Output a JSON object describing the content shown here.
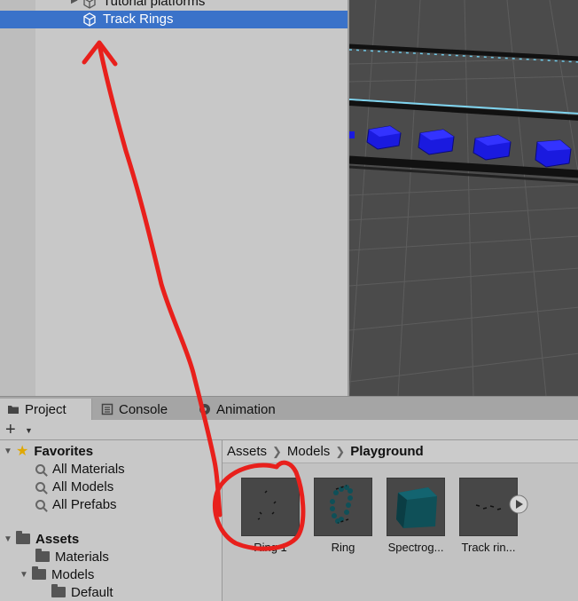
{
  "hierarchy": {
    "items": [
      {
        "label": "Tutorial platforms",
        "selected": false
      },
      {
        "label": "Track Rings",
        "selected": true
      }
    ]
  },
  "tabs": [
    {
      "label": "Project",
      "icon": "folder-icon",
      "active": true
    },
    {
      "label": "Console",
      "icon": "console-icon",
      "active": false
    },
    {
      "label": "Animation",
      "icon": "animation-icon",
      "active": false
    }
  ],
  "toolbar": {
    "add_label": "+",
    "add_icon": "chevron-down-icon"
  },
  "tree": {
    "favorites": {
      "label": "Favorites",
      "items": [
        "All Materials",
        "All Models",
        "All Prefabs"
      ]
    },
    "assets": {
      "label": "Assets",
      "items": [
        "Materials",
        "Models",
        "Default"
      ]
    }
  },
  "breadcrumb": [
    "Assets",
    "Models",
    "Playground"
  ],
  "assets": [
    {
      "name": "Ring 1"
    },
    {
      "name": "Ring"
    },
    {
      "name": "Spectrog..."
    },
    {
      "name": "Track rin..."
    }
  ],
  "colors": {
    "selection": "#3a72c9",
    "annotation": "#e8201c",
    "scene_bg": "#4b4b4b",
    "cube_blue": "#1a1adf",
    "spectro_teal": "#0f5058"
  }
}
